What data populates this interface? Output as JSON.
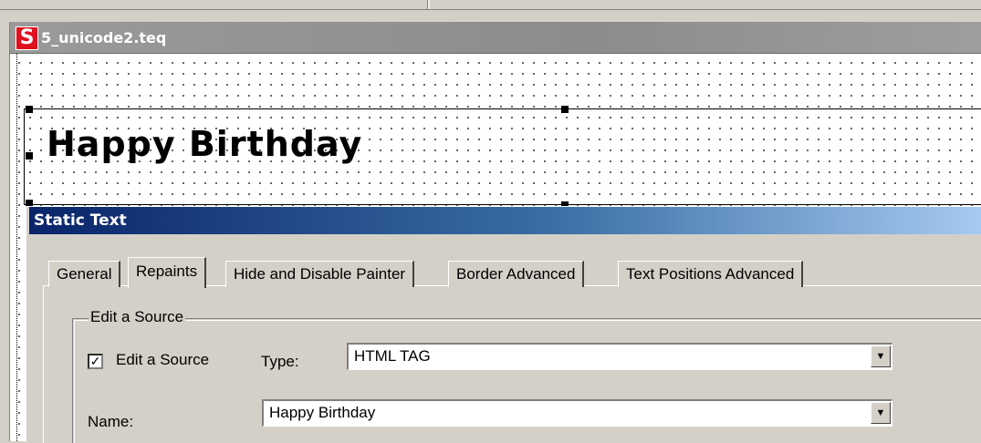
{
  "window": {
    "title": "5_unicode2.teq",
    "icon_letter": "S"
  },
  "canvas": {
    "text_object_value": "Happy Birthday"
  },
  "dialog": {
    "title": "Static Text",
    "tabs": [
      "General",
      "Repaints",
      "Hide and Disable Painter",
      "Border Advanced",
      "Text Positions Advanced"
    ],
    "active_tab": "Repaints",
    "group": {
      "legend": "Edit a Source",
      "checkbox_label": "Edit a Source",
      "checkbox_checked": true,
      "checkbox_mark": "✓",
      "type_label": "Type:",
      "type_value": "HTML TAG",
      "name_label": "Name:",
      "name_value": "Happy Birthday"
    }
  },
  "colors": {
    "app_icon": "#e0101e",
    "dialog_title_start": "#0a246a",
    "dialog_title_end": "#a6caf0",
    "face": "#d4d0c8"
  }
}
